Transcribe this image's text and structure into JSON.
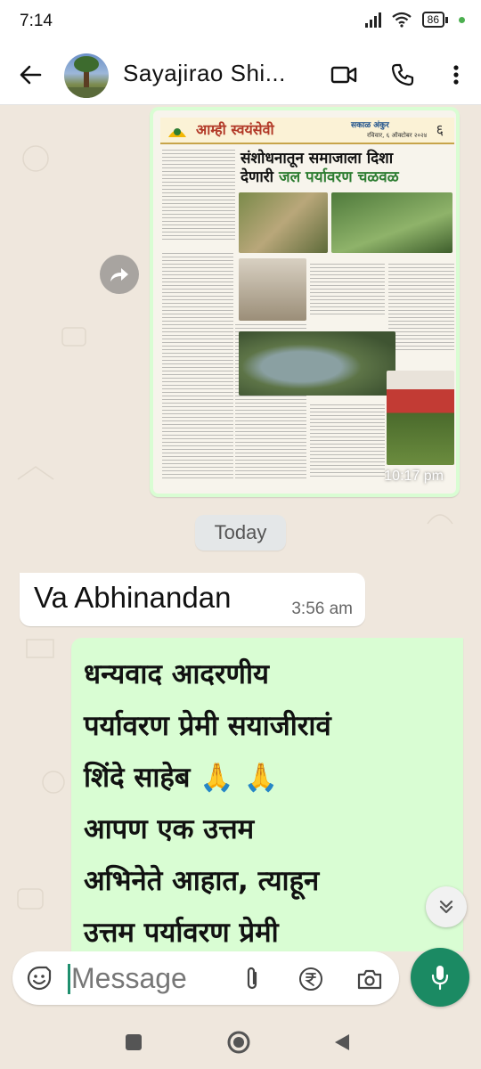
{
  "status_bar": {
    "time": "7:14",
    "battery": "86",
    "icons": [
      "signal-icon",
      "wifi-icon",
      "battery-icon",
      "notification-dot-icon"
    ]
  },
  "header": {
    "title": "Sayajirao Shi...",
    "icons": [
      "back-arrow-icon",
      "video-call-icon",
      "voice-call-icon",
      "more-options-icon"
    ]
  },
  "messages": {
    "image_message": {
      "time": "10:17 pm",
      "newspaper": {
        "masthead": "आम्ही स्वयंसेवी",
        "paper_name": "सकाळ अंकुर",
        "date": "रविवार, ६ ऑक्टोबर २०२४",
        "page_number": "६",
        "headline_line1": "संशोधनातून समाजाला दिशा",
        "headline_line2_prefix": "देणारी ",
        "headline_line2_highlight": "जल पर्यावरण चळवळ"
      }
    },
    "date_divider": "Today",
    "incoming": {
      "text": "Va Abhinandan",
      "time": "3:56 am"
    },
    "outgoing": {
      "text": "धन्यवाद आदरणीय\nपर्यावरण प्रेमी सयाजीरावं\nशिंदे साहेब 🙏 🙏\nआपण एक उत्तम\nअभिनेते आहात, त्याहून\nउत्तम पर्यावरण प्रेमी"
    }
  },
  "composer": {
    "placeholder": "Message",
    "icons": [
      "emoji-icon",
      "attach-icon",
      "rupee-icon",
      "camera-icon",
      "mic-icon"
    ]
  },
  "nav": {
    "icons": [
      "recents-icon",
      "home-icon",
      "back-icon"
    ]
  },
  "colors": {
    "accent": "#1b8a63",
    "outgoing_bubble": "#d9fdd3",
    "chat_background": "#efe7dd"
  }
}
